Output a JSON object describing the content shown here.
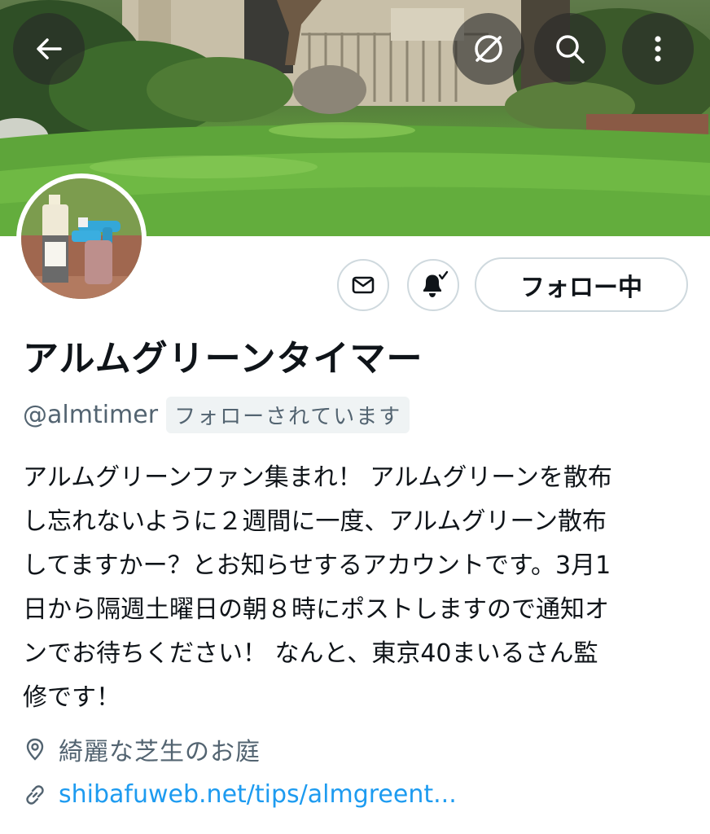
{
  "banner": {
    "back_label": "Back",
    "hide_label": "Hide",
    "search_label": "Search",
    "more_label": "More"
  },
  "actions": {
    "message_label": "Message",
    "notifications_label": "Notifications on",
    "follow_label": "フォロー中"
  },
  "profile": {
    "display_name": "アルムグリーンタイマー",
    "handle": "@almtimer",
    "follows_you": "フォローされています",
    "bio": "アルムグリーンファン集まれ！ アルムグリーンを散布\nし忘れないように２週間に一度、アルムグリーン散布\nしてますかー？とお知らせするアカウントです。3月1\n日から隔週土曜日の朝８時にポストしますので通知オ\nンでお待ちください！ なんと、東京40まいるさん監\n修です！",
    "location": "綺麗な芝生のお庭",
    "website": "shibafuweb.net/tips/almgreent..."
  },
  "colors": {
    "link": "#1d9bf0",
    "secondary_text": "#536471",
    "border": "#cfd9de"
  }
}
